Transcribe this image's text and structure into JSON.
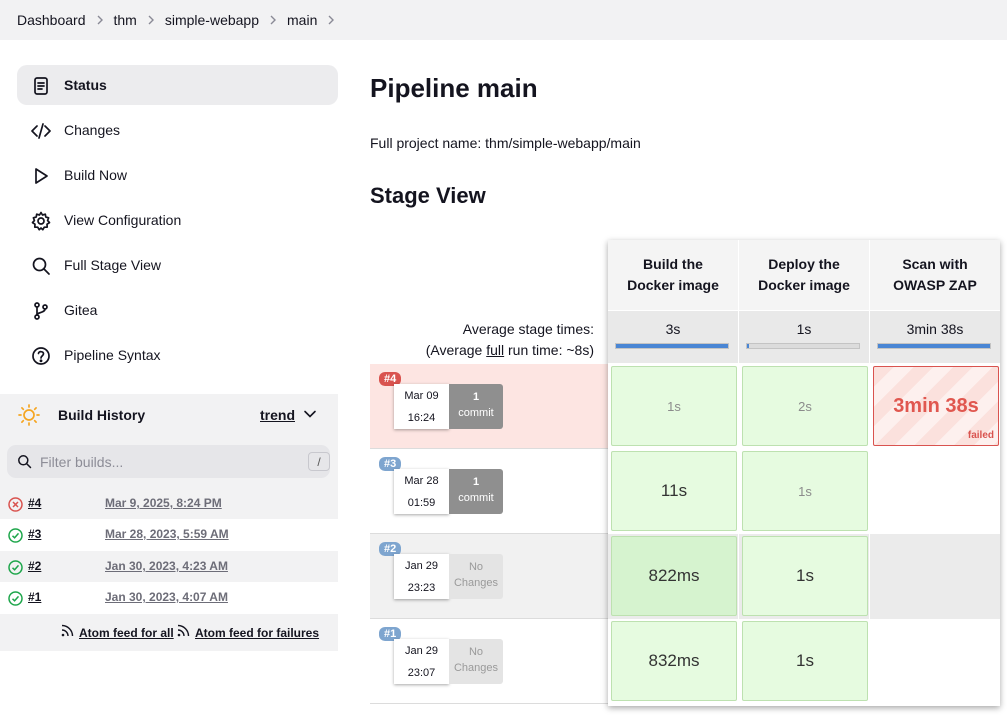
{
  "breadcrumb": [
    "Dashboard",
    "thm",
    "simple-webapp",
    "main"
  ],
  "sidebar": {
    "items": [
      {
        "label": "Status",
        "icon": "status-icon",
        "active": true
      },
      {
        "label": "Changes",
        "icon": "code-icon"
      },
      {
        "label": "Build Now",
        "icon": "play-icon"
      },
      {
        "label": "View Configuration",
        "icon": "gear-icon"
      },
      {
        "label": "Full Stage View",
        "icon": "search-icon"
      },
      {
        "label": "Gitea",
        "icon": "git-branch-icon"
      },
      {
        "label": "Pipeline Syntax",
        "icon": "help-icon"
      }
    ]
  },
  "build_history": {
    "title": "Build History",
    "trend": "trend",
    "filter_placeholder": "Filter builds...",
    "shortcut": "/",
    "builds": [
      {
        "num": "#4",
        "date": "Mar 9, 2025, 8:24 PM",
        "status": "failed"
      },
      {
        "num": "#3",
        "date": "Mar 28, 2023, 5:59 AM",
        "status": "success"
      },
      {
        "num": "#2",
        "date": "Jan 30, 2023, 4:23 AM",
        "status": "success"
      },
      {
        "num": "#1",
        "date": "Jan 30, 2023, 4:07 AM",
        "status": "success"
      }
    ],
    "feed_all": "Atom feed for all",
    "feed_failures": "Atom feed for failures"
  },
  "main": {
    "title": "Pipeline main",
    "full_name": "Full project name: thm/simple-webapp/main",
    "stage_view_title": "Stage View",
    "avg_label": "Average stage times:",
    "avg_full_prefix": "(Average ",
    "avg_full_word": "full",
    "avg_full_suffix": " run time: ~8s)"
  },
  "stages": [
    {
      "name": "Build the Docker image",
      "avg": "3s",
      "bar": 1.0
    },
    {
      "name": "Deploy the Docker image",
      "avg": "1s",
      "bar": 0.02
    },
    {
      "name": "Scan with OWASP ZAP",
      "avg": "3min 38s",
      "bar": 1.0
    }
  ],
  "runs": [
    {
      "badge": "#4",
      "date": "Mar 09",
      "time": "16:24",
      "changes_top": "1",
      "changes_bottom": "commit",
      "cells": [
        "1s",
        "2s",
        "3min 38s"
      ],
      "failed_label": "failed"
    },
    {
      "badge": "#3",
      "date": "Mar 28",
      "time": "01:59",
      "changes_top": "1",
      "changes_bottom": "commit",
      "cells": [
        "11s",
        "1s",
        ""
      ]
    },
    {
      "badge": "#2",
      "date": "Jan 29",
      "time": "23:23",
      "changes_top": "No",
      "changes_bottom": "Changes",
      "cells": [
        "822ms",
        "1s",
        ""
      ]
    },
    {
      "badge": "#1",
      "date": "Jan 29",
      "time": "23:07",
      "changes_top": "No",
      "changes_bottom": "Changes",
      "cells": [
        "832ms",
        "1s",
        ""
      ]
    }
  ],
  "colors": {
    "failed": "#d9534f",
    "success": "#1ea64b",
    "accent_bar": "#4a86d4"
  }
}
